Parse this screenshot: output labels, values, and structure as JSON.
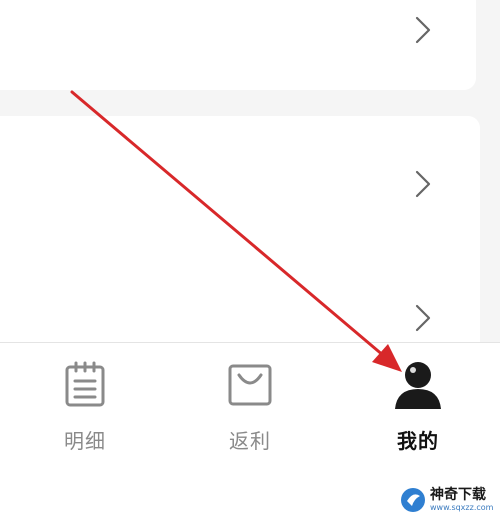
{
  "tabbar": {
    "tabs": [
      {
        "label": "明细",
        "icon": "notepad-icon",
        "active": false
      },
      {
        "label": "返利",
        "icon": "shopping-bag-icon",
        "active": false
      },
      {
        "label": "我的",
        "icon": "user-icon",
        "active": true
      }
    ]
  },
  "watermark": {
    "title": "神奇下载",
    "url": "www.sqxzz.com"
  },
  "colors": {
    "background": "#f5f5f5",
    "card": "#ffffff",
    "chevron": "#666666",
    "tab_inactive": "#8a8a8a",
    "tab_active": "#111111",
    "annotation_arrow": "#d8282a"
  }
}
